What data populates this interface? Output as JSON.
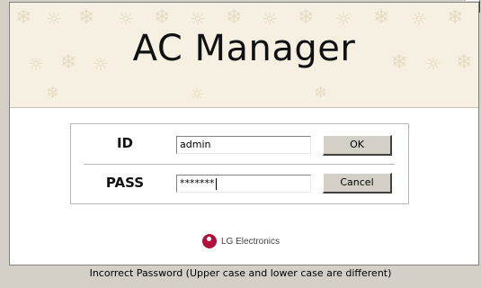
{
  "banner": {
    "title": "AC Manager"
  },
  "login": {
    "id_label": "ID",
    "id_value": "admin",
    "pass_label": "PASS",
    "pass_value": "*******",
    "ok_label": "OK",
    "cancel_label": "Cancel"
  },
  "brand": {
    "text": "LG Electronics",
    "logo_color": "#b0103a"
  },
  "status": {
    "message": "Incorrect Password (Upper case and lower case are different)"
  },
  "icons": {
    "scroll": "scroll-up-arrow-icon",
    "logo": "lg-logo-icon"
  }
}
